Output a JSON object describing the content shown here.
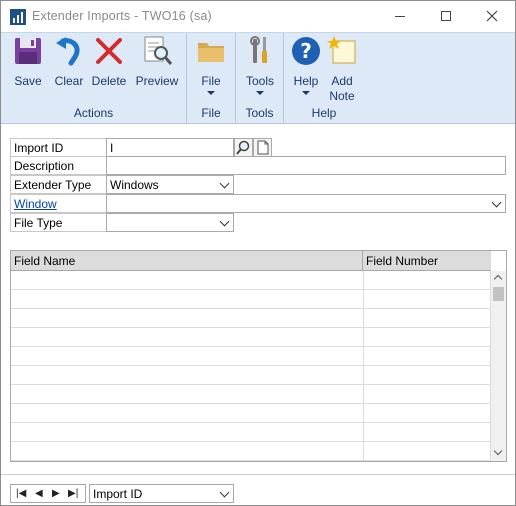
{
  "window": {
    "title": "Extender Imports  -  TWO16 (sa)"
  },
  "ribbon": {
    "actions": {
      "label": "Actions",
      "save": "Save",
      "clear": "Clear",
      "delete": "Delete",
      "preview": "Preview"
    },
    "file": {
      "label": "File",
      "button": "File"
    },
    "tools": {
      "label": "Tools",
      "button": "Tools"
    },
    "help": {
      "label": "Help",
      "help_button": "Help",
      "add_note_line1": "Add",
      "add_note_line2": "Note"
    }
  },
  "form": {
    "import_id": {
      "label": "Import ID",
      "value": "I"
    },
    "description": {
      "label": "Description",
      "value": ""
    },
    "extender_type": {
      "label": "Extender Type",
      "value": "Windows"
    },
    "window": {
      "label": "Window",
      "value": ""
    },
    "file_type": {
      "label": "File Type",
      "value": ""
    }
  },
  "grid": {
    "columns": [
      "Field Name",
      "Field Number"
    ],
    "row_count": 10
  },
  "bottom": {
    "sort_by": "Import ID"
  },
  "colors": {
    "ribbon_bg": "#dde9f6",
    "ribbon_text": "#1d3a6b",
    "link": "#0645ad"
  }
}
